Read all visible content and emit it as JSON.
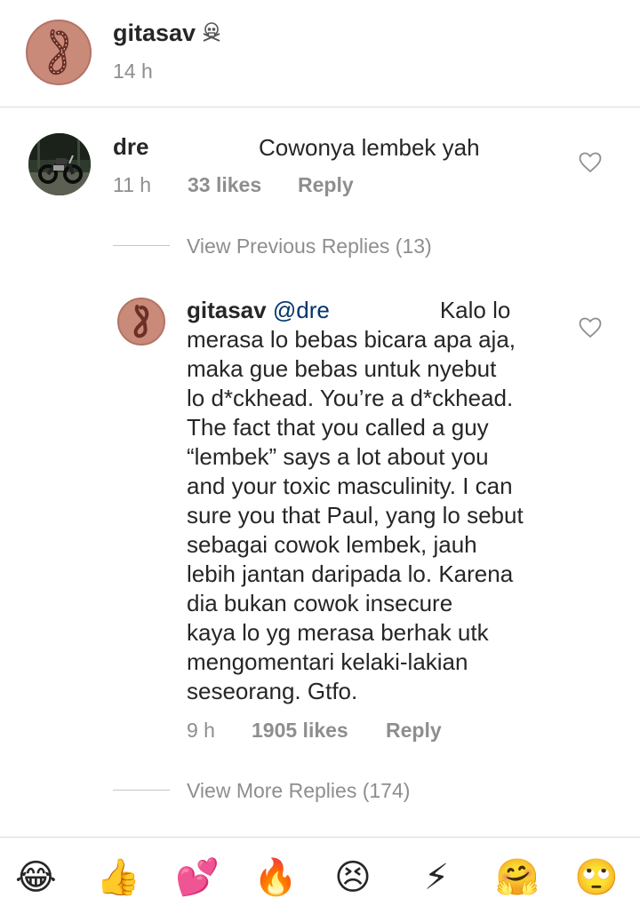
{
  "post": {
    "username": "gitasav",
    "badge_icon": "skull-crossbones-icon",
    "time": "14 h"
  },
  "comment": {
    "username": "dre",
    "text": "Cowonya lembek yah",
    "time": "11 h",
    "likes": "33 likes",
    "reply_label": "Reply",
    "avatar_icon": "motorcycle-photo"
  },
  "view_previous": "View Previous Replies (13)",
  "reply": {
    "username": "gitasav",
    "mention": "@dre",
    "text_start": "Kalo lo",
    "text_body": "merasa lo bebas bicara apa aja,\nmaka gue bebas untuk nyebut\nlo d*ckhead. You’re a d*ckhead.\nThe fact that you called a guy\n“lembek” says a lot about you\nand your toxic masculinity. I can\nsure you that Paul, yang lo sebut\nsebagai cowok lembek, jauh\nlebih jantan daripada lo. Karena\ndia bukan cowok insecure\nkaya lo yg merasa berhak utk\nmengomentari kelaki-lakian\nseseorang. Gtfo.",
    "time": "9 h",
    "likes": "1905 likes",
    "reply_label": "Reply"
  },
  "view_more": "View More Replies (174)",
  "emoji_bar": [
    {
      "icon": "laughing-face",
      "glyph": "😂"
    },
    {
      "icon": "thumbs-up",
      "glyph": "👍"
    },
    {
      "icon": "hearts",
      "glyph": "💕"
    },
    {
      "icon": "fire",
      "glyph": "🔥"
    },
    {
      "icon": "persevering-face",
      "glyph": "😣"
    },
    {
      "icon": "lightning",
      "glyph": "⚡"
    },
    {
      "icon": "hugging-face",
      "glyph": "🤗"
    },
    {
      "icon": "eye-roll-face",
      "glyph": "🙄"
    }
  ],
  "colors": {
    "text": "#262626",
    "meta": "#8e8e8e",
    "mention": "#003569",
    "avatar": "#c98a7a"
  }
}
